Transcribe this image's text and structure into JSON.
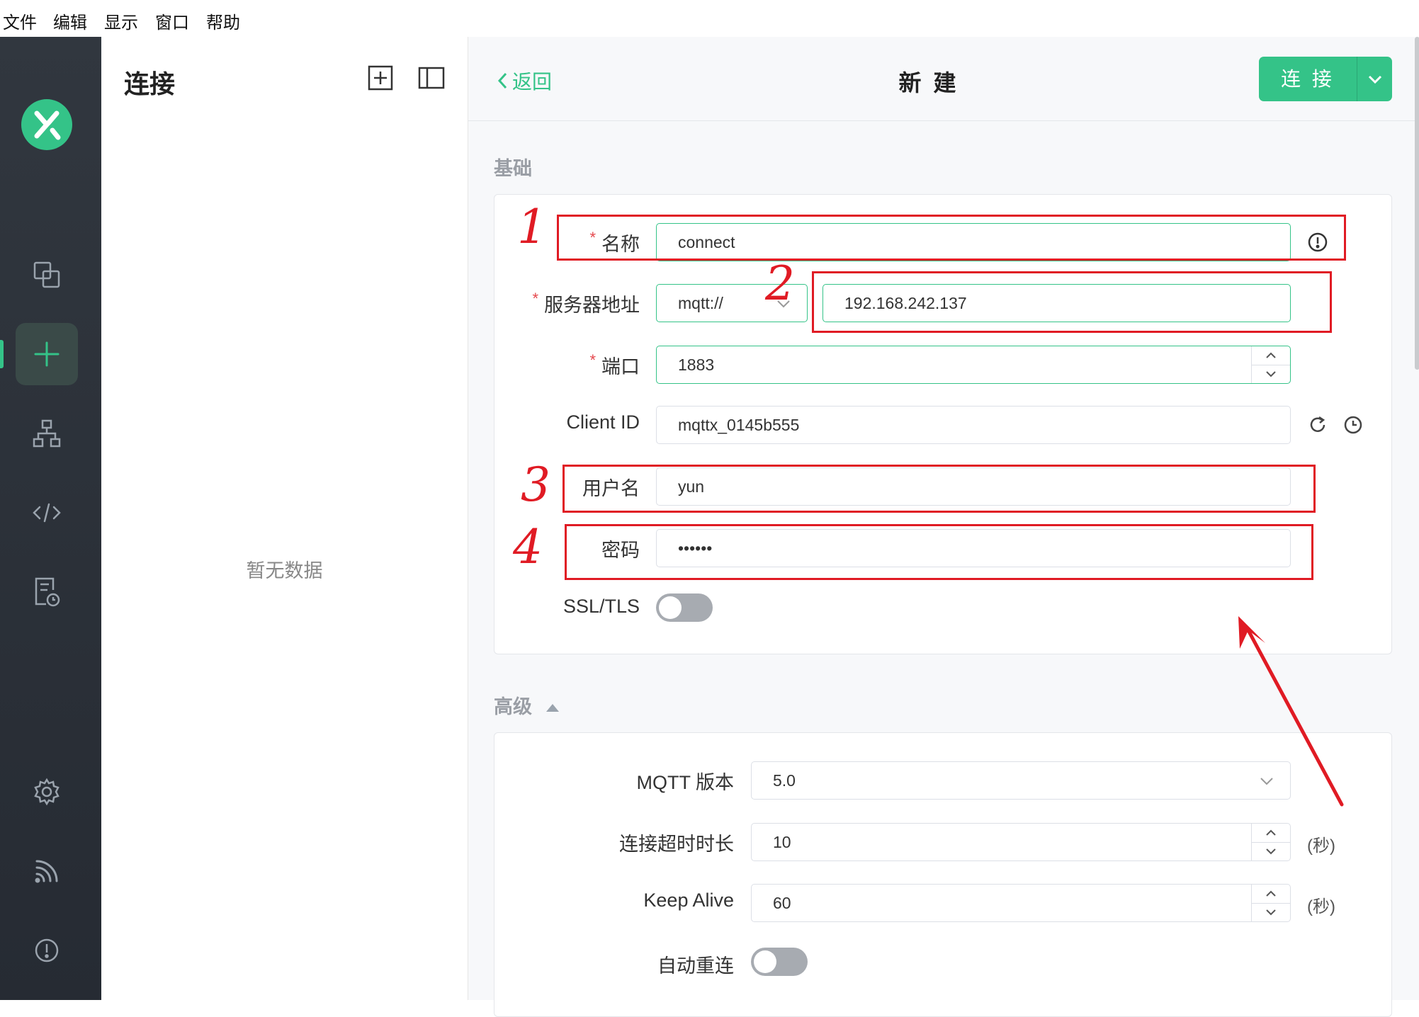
{
  "menubar": {
    "items": [
      "文件",
      "编辑",
      "显示",
      "窗口",
      "帮助"
    ]
  },
  "sidebar": {
    "icons": [
      "logo-icon",
      "connections-icon",
      "new-connection-icon",
      "topology-icon",
      "script-icon",
      "log-icon",
      "settings-icon",
      "subscription-icon",
      "about-icon"
    ]
  },
  "list_panel": {
    "title": "连接",
    "empty_text": "暂无数据"
  },
  "header": {
    "back_label": "返回",
    "title": "新 建",
    "connect_label": "连 接"
  },
  "basic": {
    "section_label": "基础",
    "name": {
      "label": "名称",
      "value": "connect"
    },
    "host": {
      "label": "服务器地址",
      "protocol": "mqtt://",
      "value": "192.168.242.137"
    },
    "port": {
      "label": "端口",
      "value": "1883"
    },
    "client_id": {
      "label": "Client ID",
      "value": "mqttx_0145b555"
    },
    "username": {
      "label": "用户名",
      "value": "yun"
    },
    "password": {
      "label": "密码",
      "value": "••••••"
    },
    "ssl": {
      "label": "SSL/TLS",
      "enabled": false
    }
  },
  "advanced": {
    "section_label": "高级",
    "mqtt_version": {
      "label": "MQTT 版本",
      "value": "5.0"
    },
    "connect_timeout": {
      "label": "连接超时时长",
      "value": "10",
      "unit": "(秒)"
    },
    "keep_alive": {
      "label": "Keep Alive",
      "value": "60",
      "unit": "(秒)"
    },
    "auto_reconnect": {
      "label": "自动重连",
      "enabled": false
    }
  },
  "annotations": {
    "marks": [
      "1",
      "2",
      "3",
      "4"
    ],
    "color": "#e01b24"
  },
  "colors": {
    "accent": "#34c388",
    "sidebar": "#2b3038"
  }
}
